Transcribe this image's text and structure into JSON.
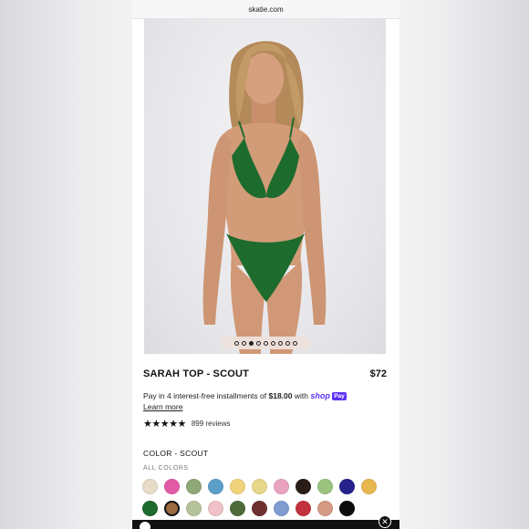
{
  "browser": {
    "url": "skatie.com"
  },
  "gallery": {
    "dot_count": 9,
    "active_index": 2
  },
  "product": {
    "title": "SARAH TOP - SCOUT",
    "price": "$72",
    "installments_prefix": "Pay in 4 interest-free installments of ",
    "installments_amount": "$18.00",
    "installments_suffix": " with ",
    "shop_logo": "shop",
    "pay_badge": "Pay",
    "learn_more": "Learn more",
    "stars": "★★★★★",
    "review_count": "899 reviews"
  },
  "color": {
    "label": "COLOR - SCOUT",
    "all_colors": "ALL COLORS",
    "selected_index": 12,
    "swatches": [
      "#e8dcc8",
      "#e25aa5",
      "#8fa877",
      "#5b9fc9",
      "#f0d27a",
      "#e8d88a",
      "#e9a3c0",
      "#2a1d18",
      "#9ac47e",
      "#26228c",
      "#e8b84f",
      "#1e6b2e",
      "#9a6a40",
      "#b6c29a",
      "#f0c2c8",
      "#4f6b3a",
      "#6e3030",
      "#7f9bd0",
      "#c2323c",
      "#d49a84",
      "#0c0c0c"
    ]
  },
  "icons": {
    "accessibility": "accessibility-icon",
    "close": "close-icon"
  }
}
